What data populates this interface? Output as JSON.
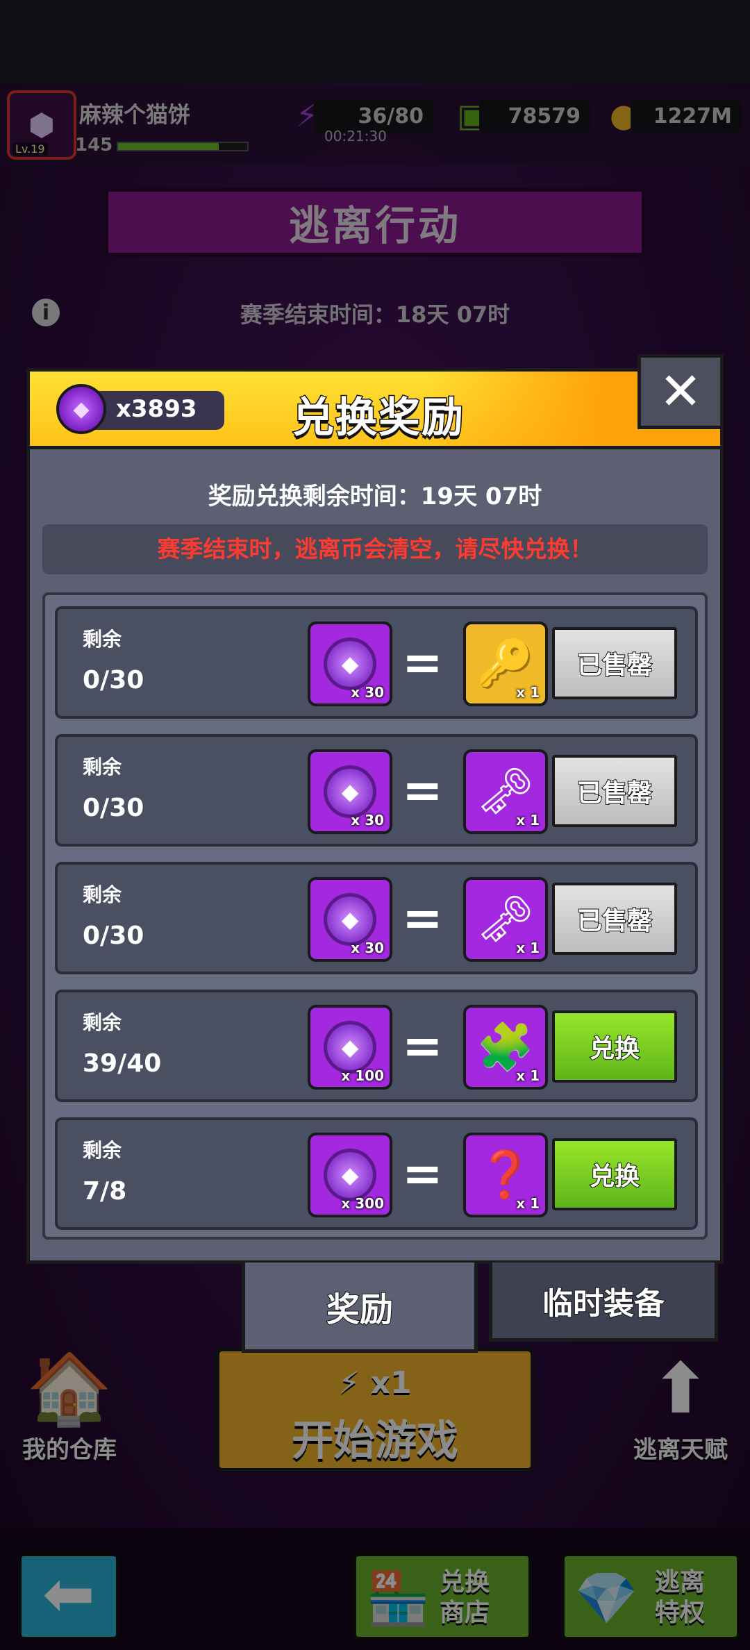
{
  "player": {
    "name": "麻辣个猫饼",
    "level": "145",
    "xp_fraction": 0.78,
    "avatar_icon": "cube-avatar-icon",
    "avatar_badge": "Lv.19"
  },
  "resources": {
    "energy": "36/80",
    "energy_timer": "00:21:30",
    "cash": "78579",
    "coins": "1227M"
  },
  "event": {
    "title": "逃离行动",
    "season_end": "赛季结束时间：18天 07时"
  },
  "modal": {
    "title": "兑换奖励",
    "gem_count": "x3893",
    "close_label": "✕",
    "remaining_time": "奖励兑换剩余时间：19天 07时",
    "warning": "赛季结束时，逃离币会清空，请尽快兑换！",
    "warning_color": "#ff3b2f",
    "rows": [
      {
        "label": "剩余",
        "count": "0/30",
        "cost_qty": "x 30",
        "reward_icon": "silver-key-icon",
        "reward_glyph": "🔑",
        "reward_qty": "x 1",
        "reward_bg": "gold",
        "button": "已售罄",
        "status": "sold"
      },
      {
        "label": "剩余",
        "count": "0/30",
        "cost_qty": "x 30",
        "reward_icon": "gold-key-purple-gem-icon",
        "reward_glyph": "🗝",
        "reward_qty": "x 1",
        "reward_bg": "purple",
        "button": "已售罄",
        "status": "sold"
      },
      {
        "label": "剩余",
        "count": "0/30",
        "cost_qty": "x 30",
        "reward_icon": "gold-key-icon",
        "reward_glyph": "🗝",
        "reward_qty": "x 1",
        "reward_bg": "purple",
        "button": "已售罄",
        "status": "sold"
      },
      {
        "label": "剩余",
        "count": "39/40",
        "cost_qty": "x 100",
        "reward_icon": "puzzle-piece-icon",
        "reward_glyph": "🧩",
        "reward_qty": "x 1",
        "reward_bg": "purple",
        "button": "兑换",
        "status": "available"
      },
      {
        "label": "剩余",
        "count": "7/8",
        "cost_qty": "x 300",
        "reward_icon": "mystery-box-icon",
        "reward_glyph": "❓",
        "reward_qty": "x 1",
        "reward_bg": "purple",
        "button": "兑换",
        "status": "available"
      }
    ]
  },
  "tabs": {
    "reward": "奖励",
    "equipment": "临时装备"
  },
  "bottom": {
    "start_multiplier": "x1",
    "start_label": "开始游戏",
    "warehouse": "我的仓库",
    "talent": "逃离天赋",
    "shop": "兑换商店",
    "privilege": "逃离特权"
  }
}
